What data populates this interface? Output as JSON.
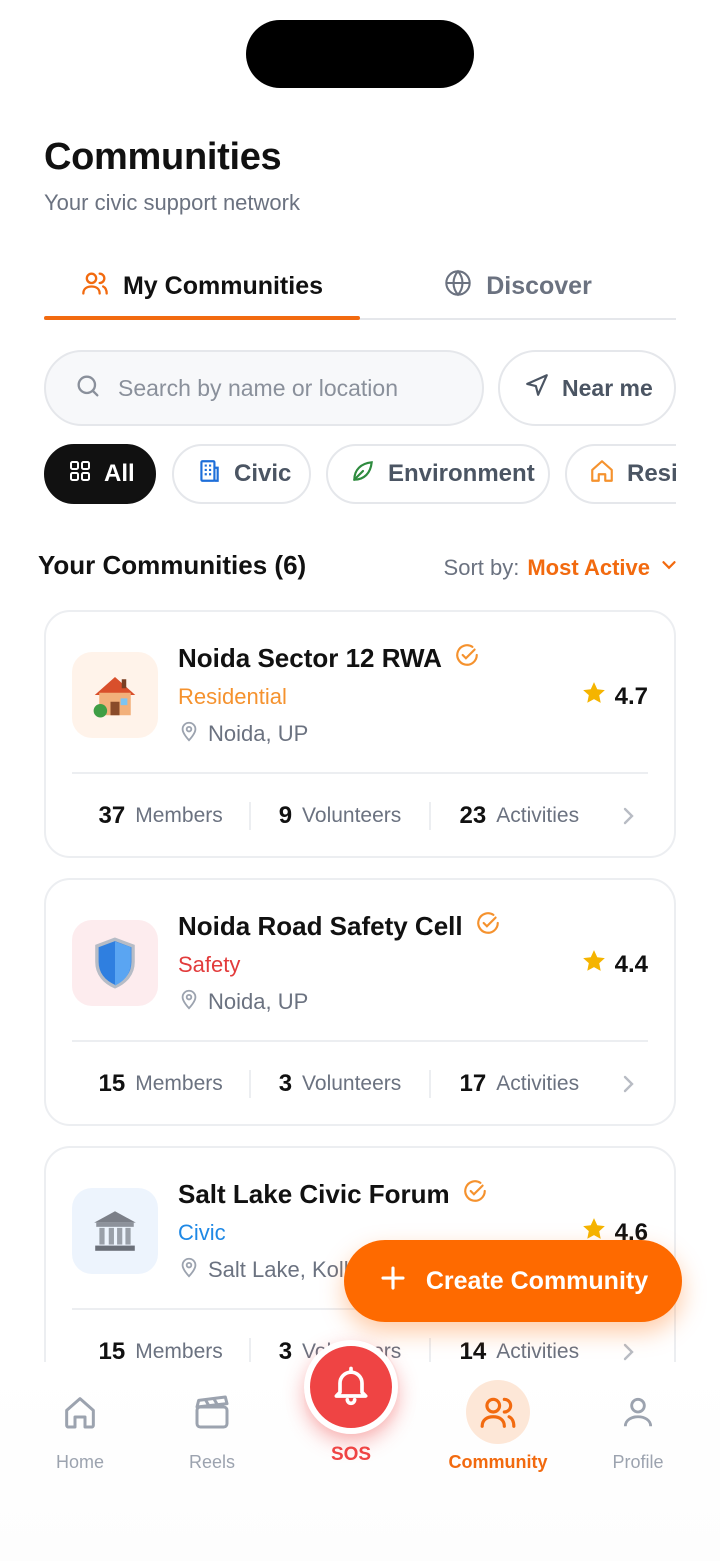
{
  "header": {
    "title": "Communities",
    "subtitle": "Your civic support network"
  },
  "tabs": [
    {
      "label": "My Communities",
      "icon": "users-icon",
      "active": true
    },
    {
      "label": "Discover",
      "icon": "globe-icon",
      "active": false
    }
  ],
  "search": {
    "placeholder": "Search by name or location",
    "near_me_label": "Near me"
  },
  "filters": [
    {
      "label": "All",
      "icon": "grid-icon",
      "active": true
    },
    {
      "label": "Civic",
      "icon": "building-icon",
      "active": false
    },
    {
      "label": "Environment",
      "icon": "leaf-icon",
      "active": false
    },
    {
      "label": "Residential",
      "icon": "home-icon",
      "active": false
    }
  ],
  "section": {
    "title": "Your Communities (6)",
    "sort_label": "Sort by:",
    "sort_value": "Most Active"
  },
  "communities": [
    {
      "name": "Noida Sector 12 RWA",
      "category": "Residential",
      "category_color": "#f5922e",
      "location": "Noida, UP",
      "rating": "4.7",
      "icon": "house-icon",
      "icon_bg": "#fff3ea",
      "members": "37",
      "members_label": "Members",
      "volunteers": "9",
      "volunteers_label": "Volunteers",
      "activities": "23",
      "activities_label": "Activities"
    },
    {
      "name": "Noida Road Safety Cell",
      "category": "Safety",
      "category_color": "#e23b3b",
      "location": "Noida, UP",
      "rating": "4.4",
      "icon": "shield-icon",
      "icon_bg": "#fdecee",
      "members": "15",
      "members_label": "Members",
      "volunteers": "3",
      "volunteers_label": "Volunteers",
      "activities": "17",
      "activities_label": "Activities"
    },
    {
      "name": "Salt Lake Civic Forum",
      "category": "Civic",
      "category_color": "#1e88e5",
      "location": "Salt Lake, Kolkata",
      "rating": "4.6",
      "icon": "government-building-icon",
      "icon_bg": "#edf4fd",
      "members": "15",
      "members_label": "Members",
      "volunteers": "3",
      "volunteers_label": "Volunteers",
      "activities": "14",
      "activities_label": "Activities"
    }
  ],
  "fab": {
    "label": "Create Community",
    "icon": "plus-icon"
  },
  "nav": [
    {
      "label": "Home",
      "icon": "home-icon"
    },
    {
      "label": "Reels",
      "icon": "clapperboard-icon"
    },
    {
      "label": "SOS",
      "icon": "bell-icon"
    },
    {
      "label": "Community",
      "icon": "users-icon",
      "active": true
    },
    {
      "label": "Profile",
      "icon": "user-icon"
    }
  ],
  "colors": {
    "accent": "#f26a0f",
    "fab": "#fe6a00",
    "sos": "#ef4444",
    "star": "#f5b400",
    "verified": "#f5922e"
  }
}
